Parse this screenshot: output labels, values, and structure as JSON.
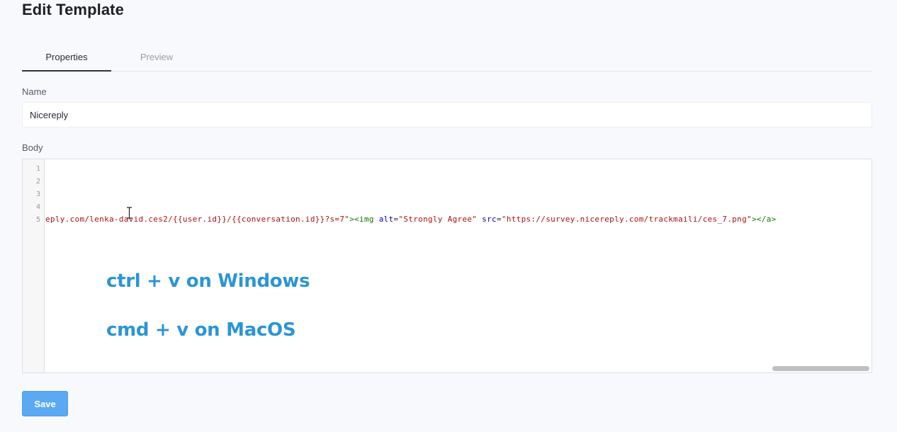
{
  "page": {
    "title": "Edit Template"
  },
  "tabs": [
    {
      "label": "Properties",
      "active": true
    },
    {
      "label": "Preview",
      "active": false
    }
  ],
  "form": {
    "name_label": "Name",
    "name_value": "Nicereply",
    "body_label": "Body"
  },
  "editor": {
    "line_numbers": [
      "1",
      "2",
      "3",
      "4",
      "5"
    ],
    "line5": {
      "str1": "eply.com/lenka-david.ces2/{{user.id}}/{{conversation.id}}?s=7\"",
      "tag1": "><img ",
      "attr1": "alt",
      "eq1": "=",
      "str2": "\"Strongly Agree\"",
      "sp1": " ",
      "attr2": "src",
      "eq2": "=",
      "str3": "\"https://survey.nicereply.com/trackmaili/ces_7.png\"",
      "tag2": "></a>"
    }
  },
  "overlay": {
    "line1": "ctrl + v on Windows",
    "line2": "cmd + v on MacOS"
  },
  "actions": {
    "save_label": "Save"
  },
  "colors": {
    "accent": "#5aa9f2",
    "overlay_text": "#2b95d6",
    "code_string": "#aa1111",
    "code_tag": "#117700",
    "code_attr": "#0000cc"
  }
}
